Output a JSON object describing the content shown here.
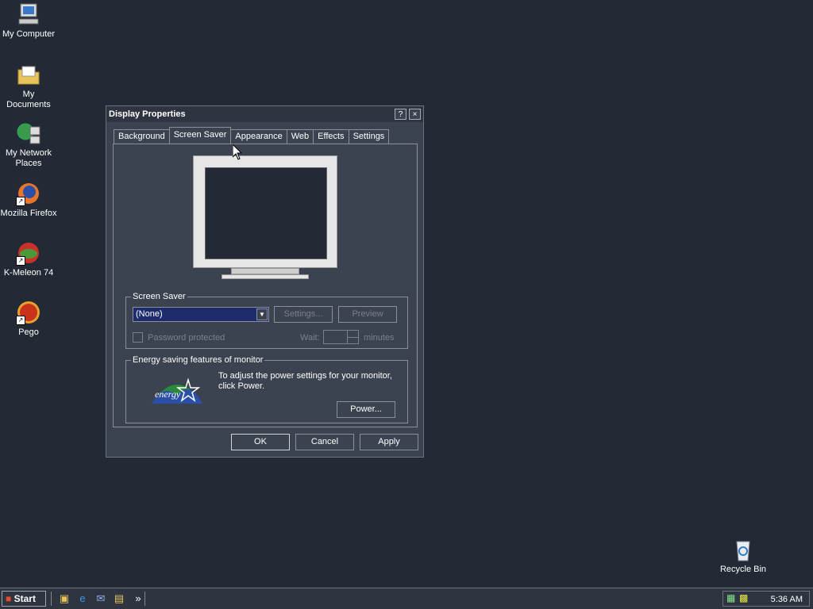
{
  "desktop": {
    "icons": [
      {
        "label": "My Computer"
      },
      {
        "label": "My Documents"
      },
      {
        "label": "My Network Places"
      },
      {
        "label": "Mozilla Firefox"
      },
      {
        "label": "K-Meleon 74"
      },
      {
        "label": "Pego"
      },
      {
        "label": "Recycle Bin"
      }
    ]
  },
  "window": {
    "title": "Display Properties",
    "help_label": "?",
    "close_label": "×",
    "tabs": [
      {
        "label": "Background"
      },
      {
        "label": "Screen Saver"
      },
      {
        "label": "Appearance"
      },
      {
        "label": "Web"
      },
      {
        "label": "Effects"
      },
      {
        "label": "Settings"
      }
    ],
    "active_tab": "Screen Saver",
    "screensaver": {
      "group_label": "Screen Saver",
      "selected": "(None)",
      "settings_label": "Settings...",
      "preview_label": "Preview",
      "password_label": "Password protected",
      "wait_label": "Wait:",
      "wait_value": "",
      "minutes_label": "minutes"
    },
    "energy": {
      "group_label": "Energy saving features of monitor",
      "logo_text": "energy",
      "description": "To adjust the power settings for your monitor, click Power.",
      "power_label": "Power..."
    },
    "buttons": {
      "ok": "OK",
      "cancel": "Cancel",
      "apply": "Apply"
    }
  },
  "taskbar": {
    "start_label": "Start",
    "chevron": "»",
    "clock": "5:36 AM"
  },
  "colors": {
    "desktop_bg": "#242a35",
    "window_bg": "#3c4350",
    "selection": "#1c2c6c"
  }
}
